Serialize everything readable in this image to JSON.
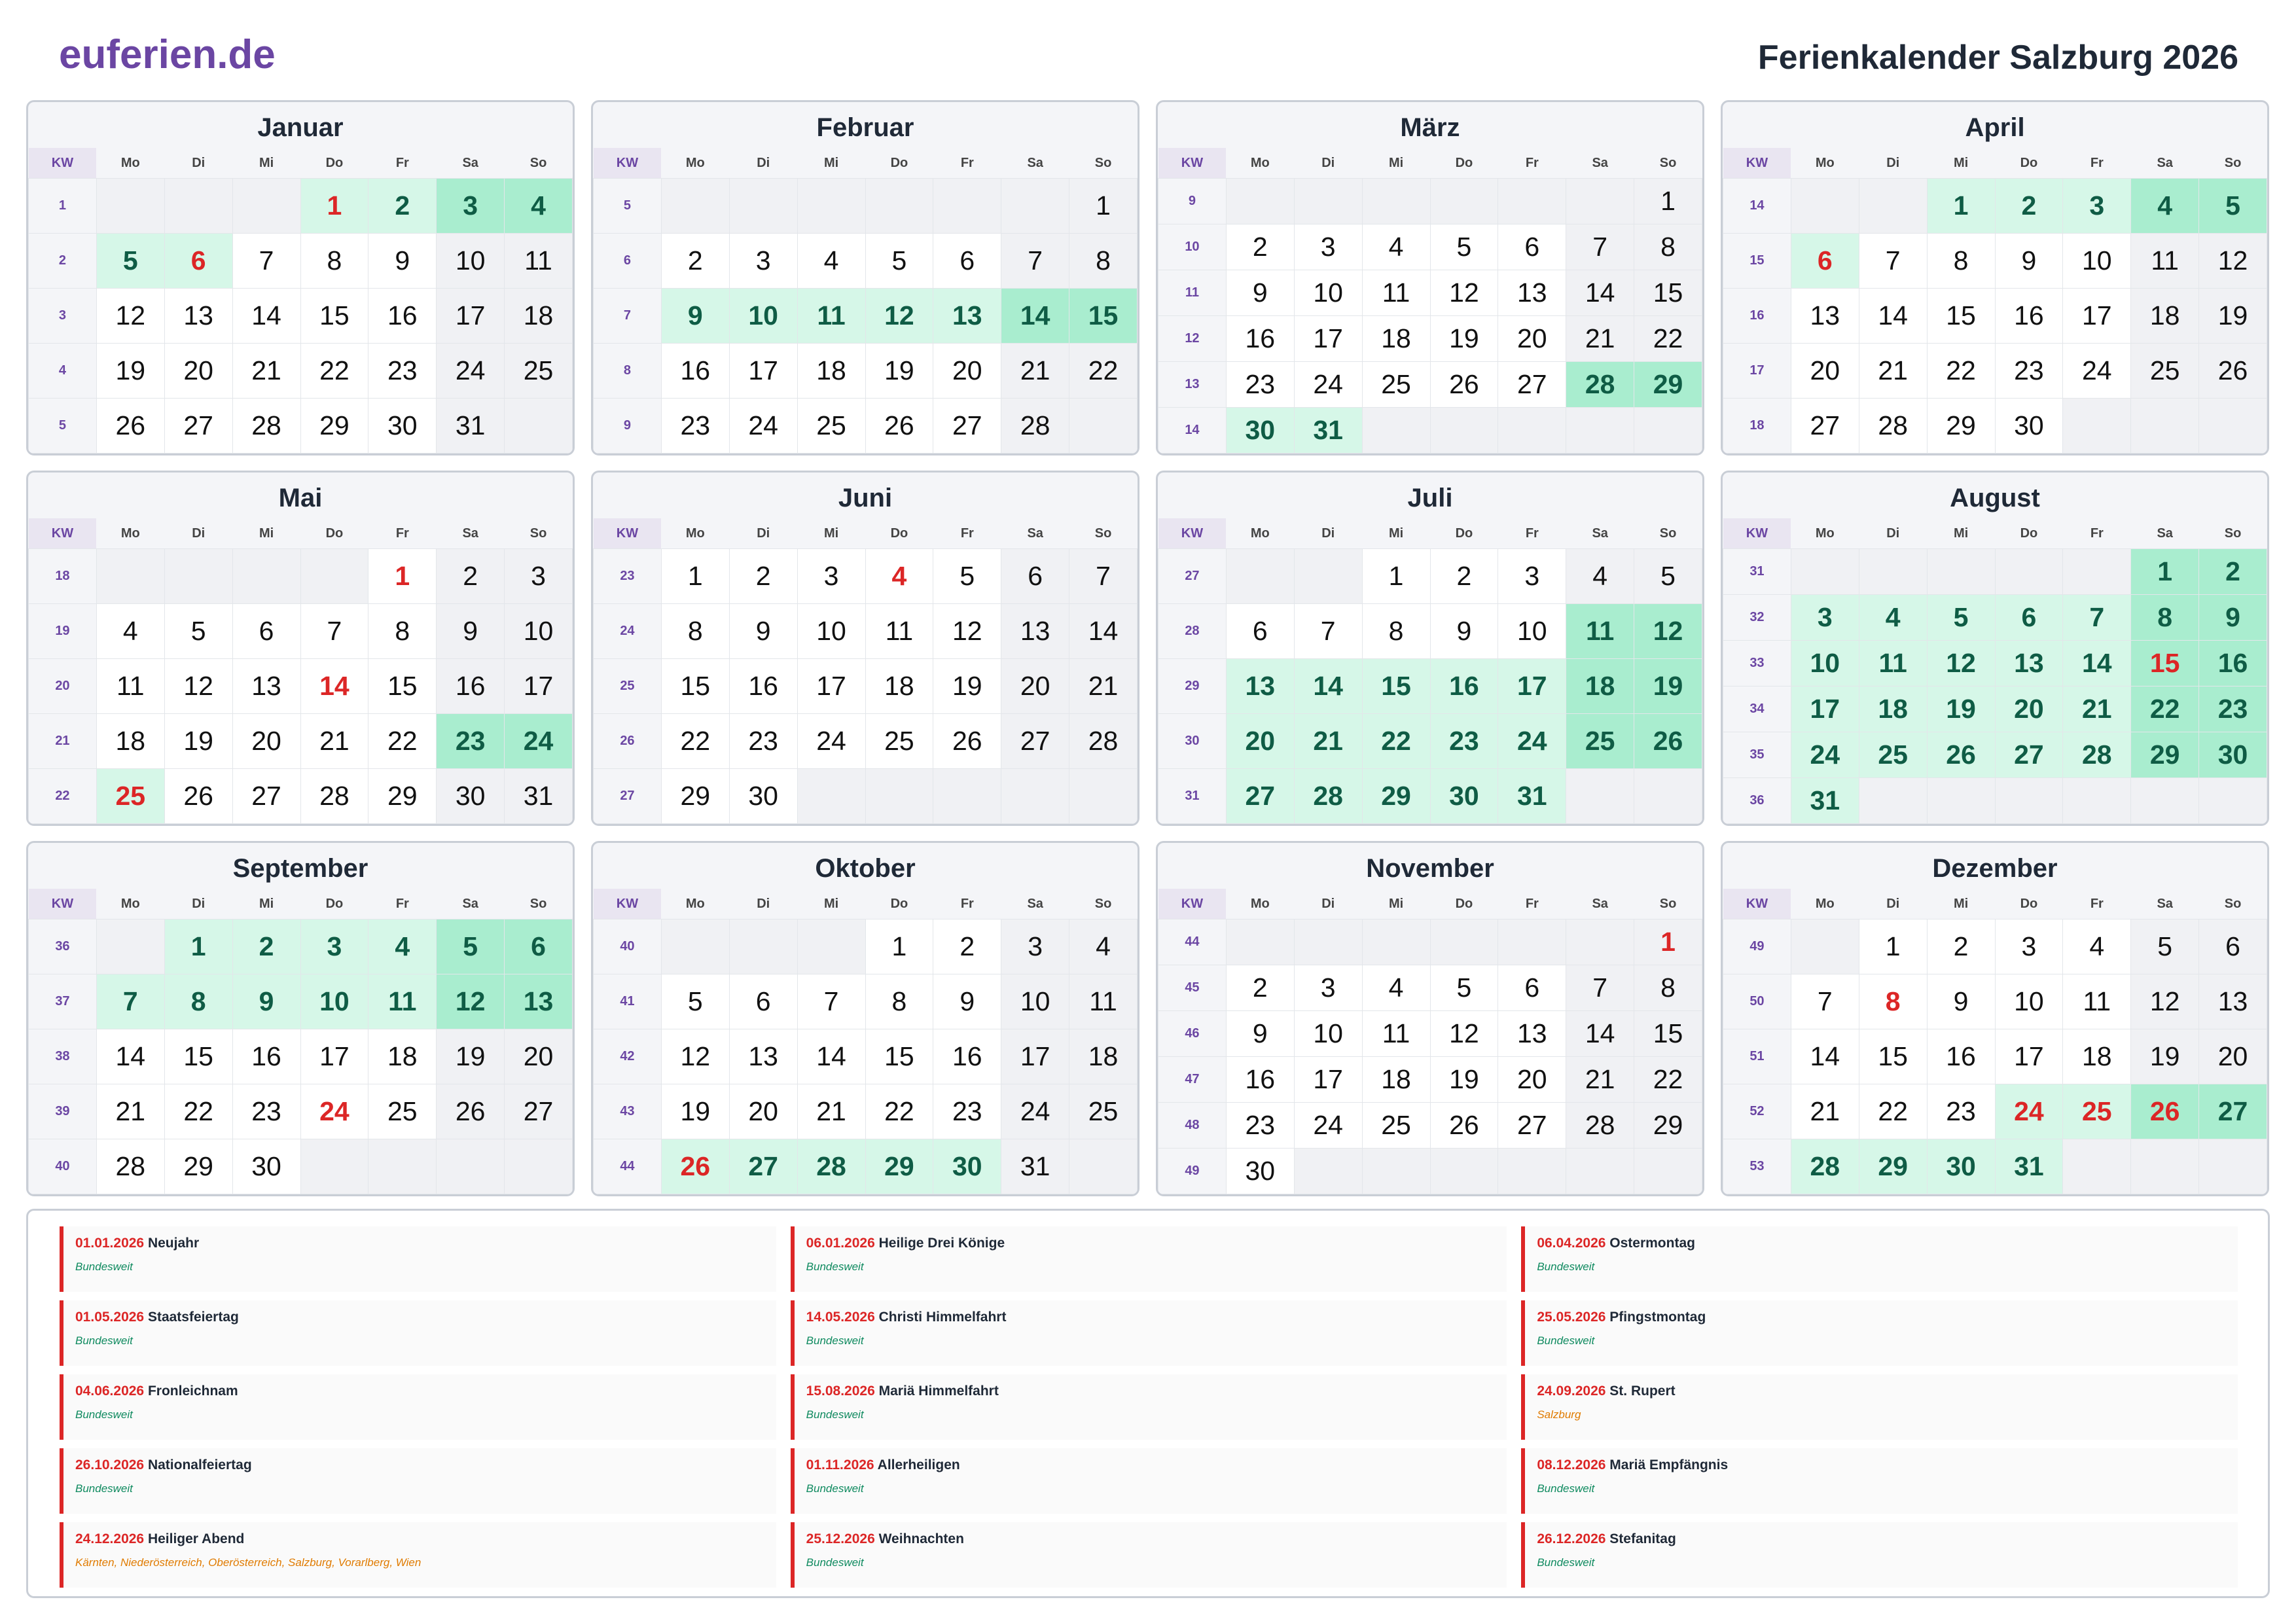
{
  "header": {
    "logo": "euferien.de",
    "title": "Ferienkalender Salzburg 2026"
  },
  "weekday_header": {
    "kw": "KW",
    "days": [
      "Mo",
      "Di",
      "Mi",
      "Do",
      "Fr",
      "Sa",
      "So"
    ]
  },
  "months": [
    {
      "name": "Januar",
      "offset": 3,
      "days": 31,
      "weeks": [
        "1",
        "2",
        "3",
        "4",
        "5"
      ],
      "vacation": [
        1,
        2,
        3,
        4,
        5,
        6
      ],
      "holidays": [
        1,
        6
      ]
    },
    {
      "name": "Februar",
      "offset": 6,
      "days": 28,
      "weeks": [
        "5",
        "6",
        "7",
        "8",
        "9"
      ],
      "vacation": [
        9,
        10,
        11,
        12,
        13,
        14,
        15
      ],
      "holidays": []
    },
    {
      "name": "März",
      "offset": 6,
      "days": 31,
      "weeks": [
        "9",
        "10",
        "11",
        "12",
        "13",
        "14"
      ],
      "vacation": [
        28,
        29,
        30,
        31
      ],
      "holidays": []
    },
    {
      "name": "April",
      "offset": 2,
      "days": 30,
      "weeks": [
        "14",
        "15",
        "16",
        "17",
        "18"
      ],
      "vacation": [
        1,
        2,
        3,
        4,
        5,
        6
      ],
      "holidays": [
        6
      ]
    },
    {
      "name": "Mai",
      "offset": 4,
      "days": 31,
      "weeks": [
        "18",
        "19",
        "20",
        "21",
        "22"
      ],
      "vacation": [
        23,
        24,
        25
      ],
      "holidays": [
        1,
        14,
        25
      ]
    },
    {
      "name": "Juni",
      "offset": 0,
      "days": 30,
      "weeks": [
        "23",
        "24",
        "25",
        "26",
        "27"
      ],
      "vacation": [],
      "holidays": [
        4
      ]
    },
    {
      "name": "Juli",
      "offset": 2,
      "days": 31,
      "weeks": [
        "27",
        "28",
        "29",
        "30",
        "31"
      ],
      "vacation": [
        11,
        12,
        13,
        14,
        15,
        16,
        17,
        18,
        19,
        20,
        21,
        22,
        23,
        24,
        25,
        26,
        27,
        28,
        29,
        30,
        31
      ],
      "holidays": []
    },
    {
      "name": "August",
      "offset": 5,
      "days": 31,
      "weeks": [
        "31",
        "32",
        "33",
        "34",
        "35",
        "36"
      ],
      "vacation": [
        1,
        2,
        3,
        4,
        5,
        6,
        7,
        8,
        9,
        10,
        11,
        12,
        13,
        14,
        15,
        16,
        17,
        18,
        19,
        20,
        21,
        22,
        23,
        24,
        25,
        26,
        27,
        28,
        29,
        30,
        31
      ],
      "holidays": [
        15
      ]
    },
    {
      "name": "September",
      "offset": 1,
      "days": 30,
      "weeks": [
        "36",
        "37",
        "38",
        "39",
        "40"
      ],
      "vacation": [
        1,
        2,
        3,
        4,
        5,
        6,
        7,
        8,
        9,
        10,
        11,
        12,
        13
      ],
      "holidays": [
        24
      ]
    },
    {
      "name": "Oktober",
      "offset": 3,
      "days": 31,
      "weeks": [
        "40",
        "41",
        "42",
        "43",
        "44"
      ],
      "vacation": [
        26,
        27,
        28,
        29,
        30
      ],
      "holidays": [
        26
      ]
    },
    {
      "name": "November",
      "offset": 6,
      "days": 30,
      "weeks": [
        "44",
        "45",
        "46",
        "47",
        "48",
        "49"
      ],
      "vacation": [],
      "holidays": [
        1
      ]
    },
    {
      "name": "Dezember",
      "offset": 1,
      "days": 31,
      "weeks": [
        "49",
        "50",
        "51",
        "52",
        "53"
      ],
      "vacation": [
        24,
        25,
        26,
        27,
        28,
        29,
        30,
        31
      ],
      "holidays": [
        8,
        24,
        25,
        26
      ]
    }
  ],
  "holidays": [
    {
      "date": "01.01.2026",
      "name": "Neujahr",
      "region": "Bundesweit",
      "region_color": "green"
    },
    {
      "date": "06.01.2026",
      "name": "Heilige Drei Könige",
      "region": "Bundesweit",
      "region_color": "green"
    },
    {
      "date": "06.04.2026",
      "name": "Ostermontag",
      "region": "Bundesweit",
      "region_color": "green"
    },
    {
      "date": "01.05.2026",
      "name": "Staatsfeiertag",
      "region": "Bundesweit",
      "region_color": "green"
    },
    {
      "date": "14.05.2026",
      "name": "Christi Himmelfahrt",
      "region": "Bundesweit",
      "region_color": "green"
    },
    {
      "date": "25.05.2026",
      "name": "Pfingstmontag",
      "region": "Bundesweit",
      "region_color": "green"
    },
    {
      "date": "04.06.2026",
      "name": "Fronleichnam",
      "region": "Bundesweit",
      "region_color": "green"
    },
    {
      "date": "15.08.2026",
      "name": "Mariä Himmelfahrt",
      "region": "Bundesweit",
      "region_color": "green"
    },
    {
      "date": "24.09.2026",
      "name": "St. Rupert",
      "region": "Salzburg",
      "region_color": "orange"
    },
    {
      "date": "26.10.2026",
      "name": "Nationalfeiertag",
      "region": "Bundesweit",
      "region_color": "green"
    },
    {
      "date": "01.11.2026",
      "name": "Allerheiligen",
      "region": "Bundesweit",
      "region_color": "green"
    },
    {
      "date": "08.12.2026",
      "name": "Mariä Empfängnis",
      "region": "Bundesweit",
      "region_color": "green"
    },
    {
      "date": "24.12.2026",
      "name": "Heiliger Abend",
      "region": "Kärnten, Niederösterreich, Oberösterreich, Salzburg, Vorarlberg, Wien",
      "region_color": "orange"
    },
    {
      "date": "25.12.2026",
      "name": "Weihnachten",
      "region": "Bundesweit",
      "region_color": "green"
    },
    {
      "date": "26.12.2026",
      "name": "Stefanitag",
      "region": "Bundesweit",
      "region_color": "green"
    }
  ]
}
